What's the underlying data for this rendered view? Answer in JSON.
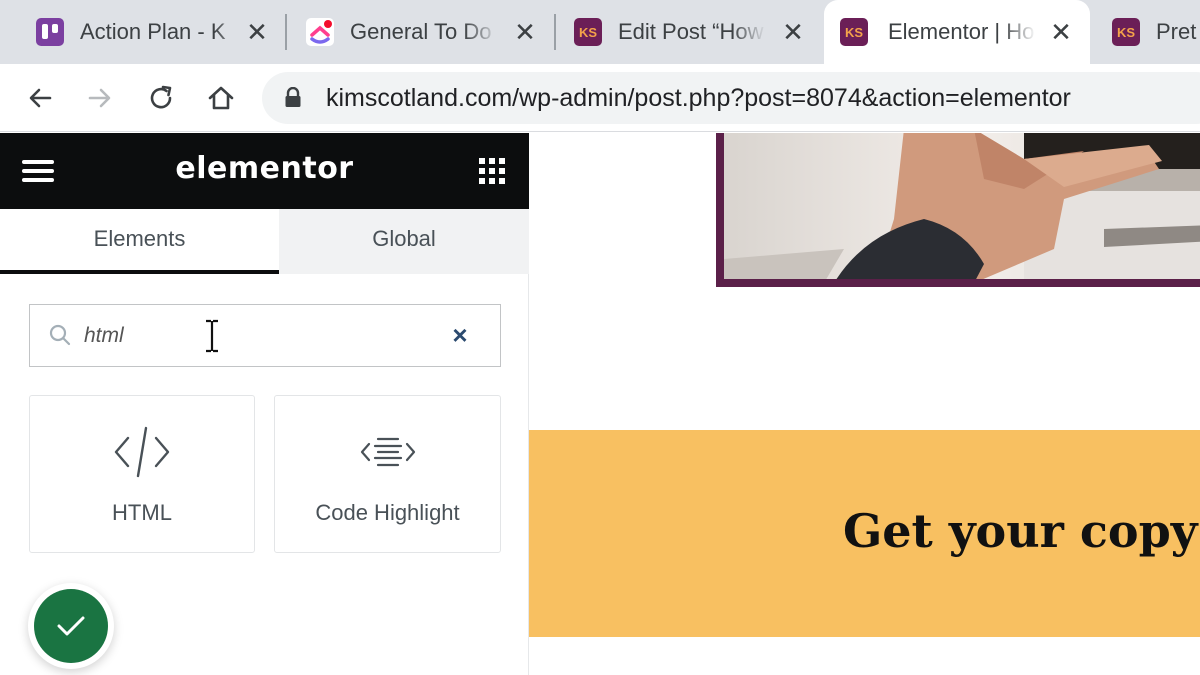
{
  "browser": {
    "tabs": [
      {
        "title": "Action Plan - K",
        "favicon": "trello-icon",
        "active": false
      },
      {
        "title": "General To Do",
        "favicon": "clickup-icon",
        "active": false
      },
      {
        "title": "Edit Post “How",
        "favicon": "ks-icon",
        "active": false
      },
      {
        "title": "Elementor | Ho",
        "favicon": "ks-icon",
        "active": true
      },
      {
        "title": "Pret",
        "favicon": "ks-icon",
        "active": false
      }
    ],
    "favicon_text": "KS",
    "close_glyph": "✕",
    "url": "kimscotland.com/wp-admin/post.php?post=8074&action=elementor"
  },
  "panel": {
    "logo": "elementor",
    "tabs": {
      "elements": "Elements",
      "global": "Global"
    },
    "search": {
      "value": "html",
      "clear_glyph": "×"
    },
    "widgets": [
      {
        "label": "HTML",
        "icon": "code-icon"
      },
      {
        "label": "Code Highlight",
        "icon": "code-highlight-icon"
      }
    ]
  },
  "canvas": {
    "banner_text": "Get your copy o"
  },
  "colors": {
    "header_bg": "#0c0d0e",
    "publish_green": "#1a7442",
    "banner_bg": "#f8c061",
    "photo_border": "#5b2049"
  }
}
